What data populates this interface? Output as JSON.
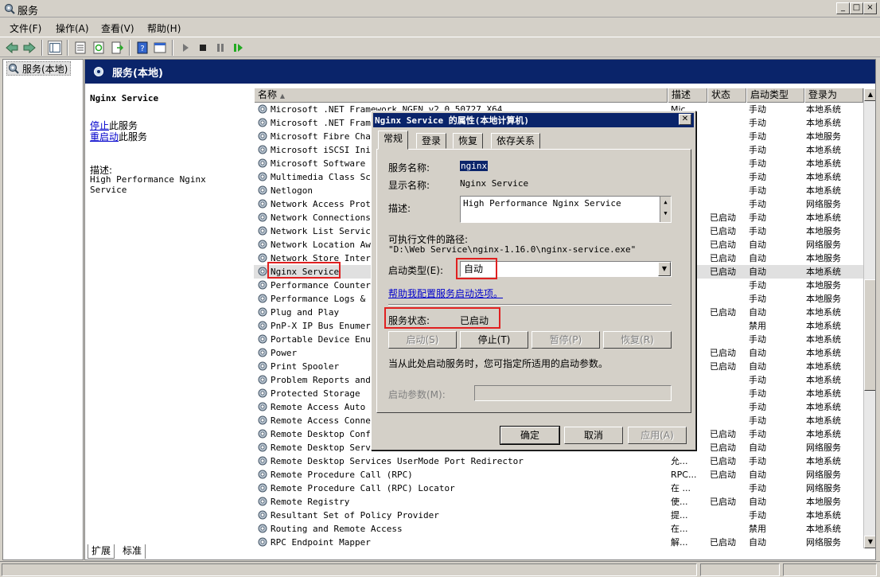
{
  "window": {
    "title": "服务",
    "controls": [
      "_",
      "□",
      "×"
    ]
  },
  "menu": [
    "文件(F)",
    "操作(A)",
    "查看(V)",
    "帮助(H)"
  ],
  "tree": {
    "root_label": "服务(本地)"
  },
  "main": {
    "header_title": "服务(本地)",
    "detail": {
      "service_title": "Nginx Service",
      "stop_link": "停止",
      "stop_suffix": "此服务",
      "restart_link": "重启动",
      "restart_suffix": "此服务",
      "desc_label": "描述:",
      "desc_text": "High Performance Nginx Service"
    },
    "columns": [
      "名称",
      "描述",
      "状态",
      "启动类型",
      "登录为"
    ],
    "rows": [
      {
        "name": "Microsoft .NET Framework NGEN v2.0.50727_X64",
        "desc": "Mic...",
        "status": "",
        "type": "手动",
        "logon": "本地系统"
      },
      {
        "name": "Microsoft .NET Framework NGEN v2.0.50727_X86",
        "desc": "",
        "status": "",
        "type": "手动",
        "logon": "本地系统"
      },
      {
        "name": "Microsoft Fibre Channel Platform Registration Service",
        "desc": "",
        "status": "",
        "type": "手动",
        "logon": "本地服务"
      },
      {
        "name": "Microsoft iSCSI Initiator Service",
        "desc": "",
        "status": "",
        "type": "手动",
        "logon": "本地系统"
      },
      {
        "name": "Microsoft Software Shadow Copy Provider",
        "desc": "",
        "status": "",
        "type": "手动",
        "logon": "本地系统"
      },
      {
        "name": "Multimedia Class Scheduler",
        "desc": "",
        "status": "",
        "type": "手动",
        "logon": "本地系统"
      },
      {
        "name": "Netlogon",
        "desc": "",
        "status": "",
        "type": "手动",
        "logon": "本地系统"
      },
      {
        "name": "Network Access Protection Agent",
        "desc": "",
        "status": "",
        "type": "手动",
        "logon": "网络服务"
      },
      {
        "name": "Network Connections",
        "desc": "",
        "status": "已启动",
        "type": "手动",
        "logon": "本地系统"
      },
      {
        "name": "Network List Service",
        "desc": "",
        "status": "已启动",
        "type": "手动",
        "logon": "本地服务"
      },
      {
        "name": "Network Location Awareness",
        "desc": "",
        "status": "已启动",
        "type": "自动",
        "logon": "网络服务"
      },
      {
        "name": "Network Store Interface Service",
        "desc": "",
        "status": "已启动",
        "type": "自动",
        "logon": "本地服务"
      },
      {
        "name": "Nginx Service",
        "desc": "",
        "status": "已启动",
        "type": "自动",
        "logon": "本地系统"
      },
      {
        "name": "Performance Counter DLL Host",
        "desc": "",
        "status": "",
        "type": "手动",
        "logon": "本地服务"
      },
      {
        "name": "Performance Logs & Alerts",
        "desc": "",
        "status": "",
        "type": "手动",
        "logon": "本地服务"
      },
      {
        "name": "Plug and Play",
        "desc": "",
        "status": "已启动",
        "type": "自动",
        "logon": "本地系统"
      },
      {
        "name": "PnP-X IP Bus Enumerator",
        "desc": "",
        "status": "",
        "type": "禁用",
        "logon": "本地系统"
      },
      {
        "name": "Portable Device Enumerator Service",
        "desc": "",
        "status": "",
        "type": "手动",
        "logon": "本地系统"
      },
      {
        "name": "Power",
        "desc": "",
        "status": "已启动",
        "type": "自动",
        "logon": "本地系统"
      },
      {
        "name": "Print Spooler",
        "desc": "",
        "status": "已启动",
        "type": "自动",
        "logon": "本地系统"
      },
      {
        "name": "Problem Reports and Solutions Control Panel Support",
        "desc": "",
        "status": "",
        "type": "手动",
        "logon": "本地系统"
      },
      {
        "name": "Protected Storage",
        "desc": "",
        "status": "",
        "type": "手动",
        "logon": "本地系统"
      },
      {
        "name": "Remote Access Auto Connection Manager",
        "desc": "",
        "status": "",
        "type": "手动",
        "logon": "本地系统"
      },
      {
        "name": "Remote Access Connection Manager",
        "desc": "",
        "status": "",
        "type": "手动",
        "logon": "本地系统"
      },
      {
        "name": "Remote Desktop Configuration",
        "desc": "",
        "status": "已启动",
        "type": "手动",
        "logon": "本地系统"
      },
      {
        "name": "Remote Desktop Services",
        "desc": "",
        "status": "已启动",
        "type": "自动",
        "logon": "网络服务"
      },
      {
        "name": "Remote Desktop Services UserMode Port Redirector",
        "desc": "允...",
        "status": "已启动",
        "type": "手动",
        "logon": "本地系统"
      },
      {
        "name": "Remote Procedure Call (RPC)",
        "desc": "RPC...",
        "status": "已启动",
        "type": "自动",
        "logon": "网络服务"
      },
      {
        "name": "Remote Procedure Call (RPC) Locator",
        "desc": "在 ...",
        "status": "",
        "type": "手动",
        "logon": "网络服务"
      },
      {
        "name": "Remote Registry",
        "desc": "使...",
        "status": "已启动",
        "type": "自动",
        "logon": "本地服务"
      },
      {
        "name": "Resultant Set of Policy Provider",
        "desc": "提...",
        "status": "",
        "type": "手动",
        "logon": "本地系统"
      },
      {
        "name": "Routing and Remote Access",
        "desc": "在...",
        "status": "",
        "type": "禁用",
        "logon": "本地系统"
      },
      {
        "name": "RPC Endpoint Mapper",
        "desc": "解...",
        "status": "已启动",
        "type": "自动",
        "logon": "网络服务"
      }
    ]
  },
  "bottom_tabs": [
    "扩展",
    "标准"
  ],
  "dialog": {
    "title": "Nginx Service 的属性(本地计算机)",
    "tabs": [
      "常规",
      "登录",
      "恢复",
      "依存关系"
    ],
    "service_name_label": "服务名称:",
    "service_name": "nginx",
    "display_name_label": "显示名称:",
    "display_name": "Nginx Service",
    "desc_label": "描述:",
    "desc": "High Performance Nginx Service",
    "path_label": "可执行文件的路径:",
    "path": "\"D:\\Web Service\\nginx-1.16.0\\nginx-service.exe\"",
    "startup_label": "启动类型(E):",
    "startup_value": "自动",
    "help_link": "帮助我配置服务启动选项。",
    "status_label": "服务状态:",
    "status_value": "已启动",
    "btn_start": "启动(S)",
    "btn_stop": "停止(T)",
    "btn_pause": "暂停(P)",
    "btn_resume": "恢复(R)",
    "hint": "当从此处启动服务时，您可指定所适用的启动参数。",
    "param_label": "启动参数(M):",
    "btn_ok": "确定",
    "btn_cancel": "取消",
    "btn_apply": "应用(A)"
  }
}
